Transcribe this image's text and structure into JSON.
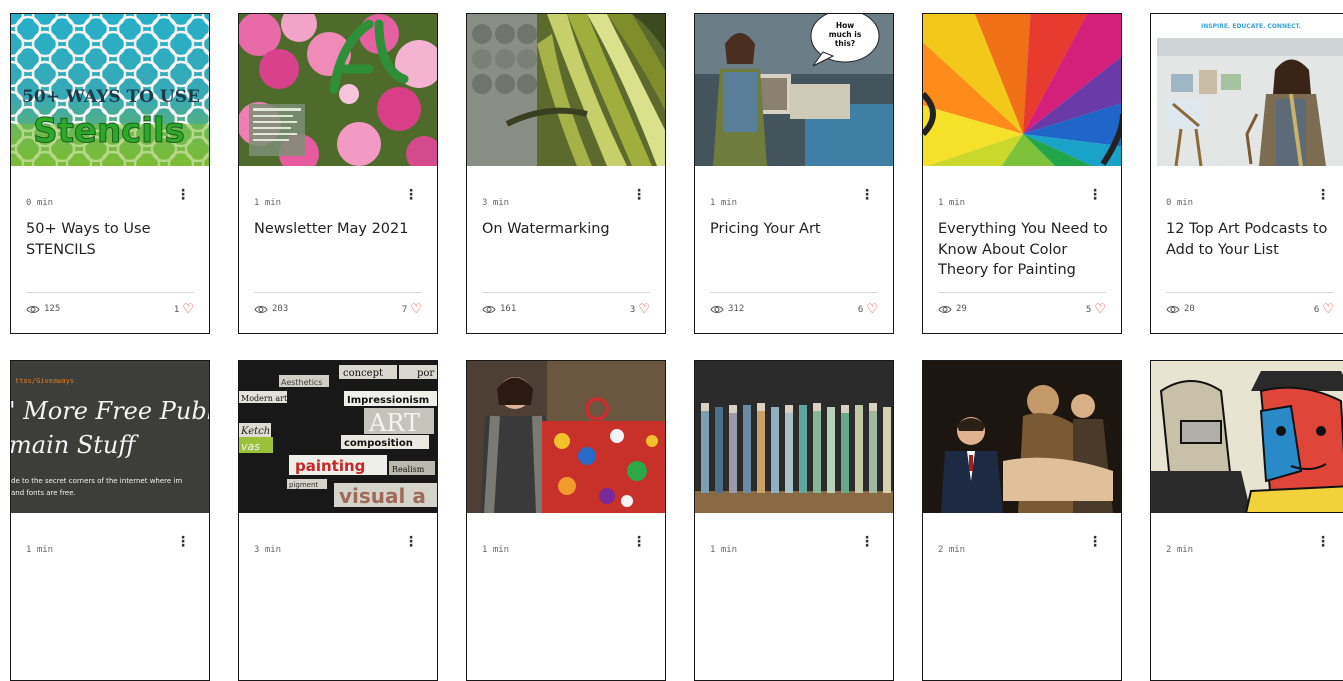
{
  "posts": [
    {
      "read_time": "0 min",
      "title": "50+ Ways to Use STENCILS",
      "views": "125",
      "likes": "1",
      "image": {
        "alt": "50+ WAYS TO USE Stencils",
        "line1": "50+ WAYS TO USE",
        "line2": "Stencils"
      }
    },
    {
      "read_time": "1 min",
      "title": "Newsletter May 2021",
      "views": "203",
      "likes": "7",
      "image": {
        "alt": "pink blossoms"
      }
    },
    {
      "read_time": "3 min",
      "title": "On Watermarking",
      "views": "161",
      "likes": "3",
      "image": {
        "alt": "folded paper art"
      }
    },
    {
      "read_time": "1 min",
      "title": "Pricing Your Art",
      "views": "312",
      "likes": "6",
      "image": {
        "alt": "artist at booth",
        "bubble": "How much is this?"
      }
    },
    {
      "read_time": "1 min",
      "title": "Everything You Need to Know About Color Theory for Painting",
      "views": "29",
      "likes": "5",
      "image": {
        "alt": "color wheel"
      }
    },
    {
      "read_time": "0 min",
      "title": "12 Top Art Podcasts to Add to Your List",
      "views": "20",
      "likes": "6",
      "image": {
        "alt": "artist in studio",
        "banner": "INSPIRE. EDUCATE. CONNECT."
      }
    },
    {
      "read_time": "1 min",
      "image": {
        "alt": "free public domain stuff",
        "tag": "ttos/Giveaways",
        "heading1": "' More Free Publ",
        "heading2": "main Stuff",
        "sub1": "de to the secret corners of the internet where im",
        "sub2": "and fonts are free."
      }
    },
    {
      "read_time": "3 min",
      "image": {
        "alt": "art vocabulary word collage",
        "w1": "concept",
        "w2": "por",
        "w3": "Aesthetics",
        "w4": "Modern art",
        "w5": "Impressionism",
        "w6": "ART",
        "w7": "Ketch",
        "w8": "composition",
        "w9": "vas",
        "w10": "painting",
        "w11": "pigment",
        "w12": "visual a",
        "w13": "Realism"
      }
    },
    {
      "read_time": "1 min",
      "image": {
        "alt": "artist with abstract painting"
      }
    },
    {
      "read_time": "1 min",
      "image": {
        "alt": "tubes of pastel pigment"
      }
    },
    {
      "read_time": "2 min",
      "image": {
        "alt": "man in front of baroque painting"
      }
    },
    {
      "read_time": "2 min",
      "image": {
        "alt": "pop art portraits"
      }
    }
  ]
}
